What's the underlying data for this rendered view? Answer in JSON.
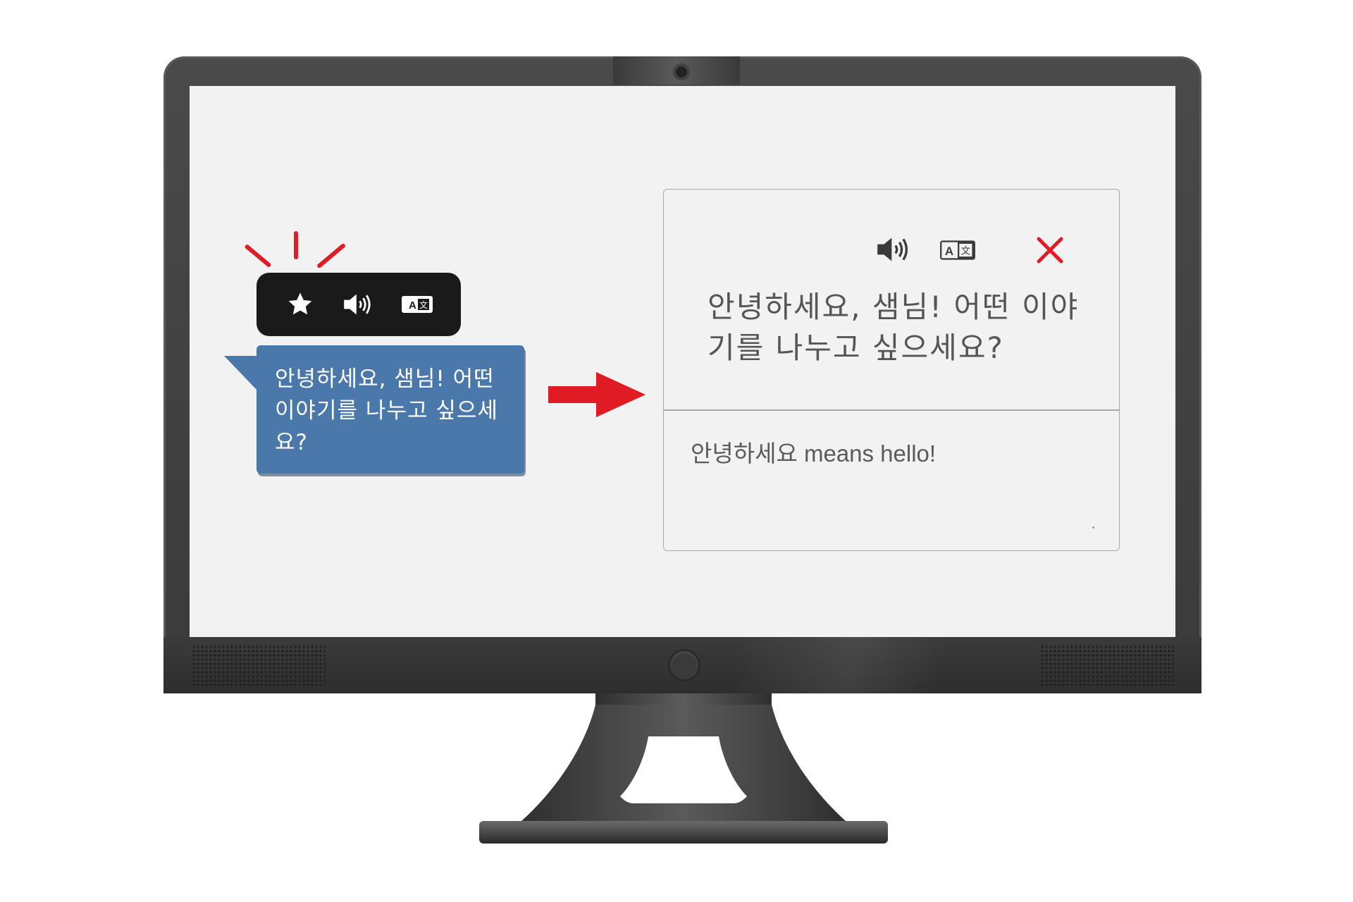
{
  "chat_bubble": {
    "text": "안녕하세요, 샘님! 어떤 이야기를 나누고 싶으세요?"
  },
  "toolbar": {
    "icons": [
      "star-icon",
      "speaker-icon",
      "translate-icon"
    ]
  },
  "popup": {
    "original_text": "안녕하세요, 샘님! 어떤 이야기를 나누고 싶으세요?",
    "translation": "안녕하세요 means hello!",
    "icons": [
      "speaker-icon",
      "translate-icon",
      "close-icon"
    ]
  },
  "colors": {
    "bubble": "#4a78aa",
    "toolbar": "#1a1a1a",
    "accent_red": "#e01b24",
    "screen": "#f2f2f2"
  }
}
